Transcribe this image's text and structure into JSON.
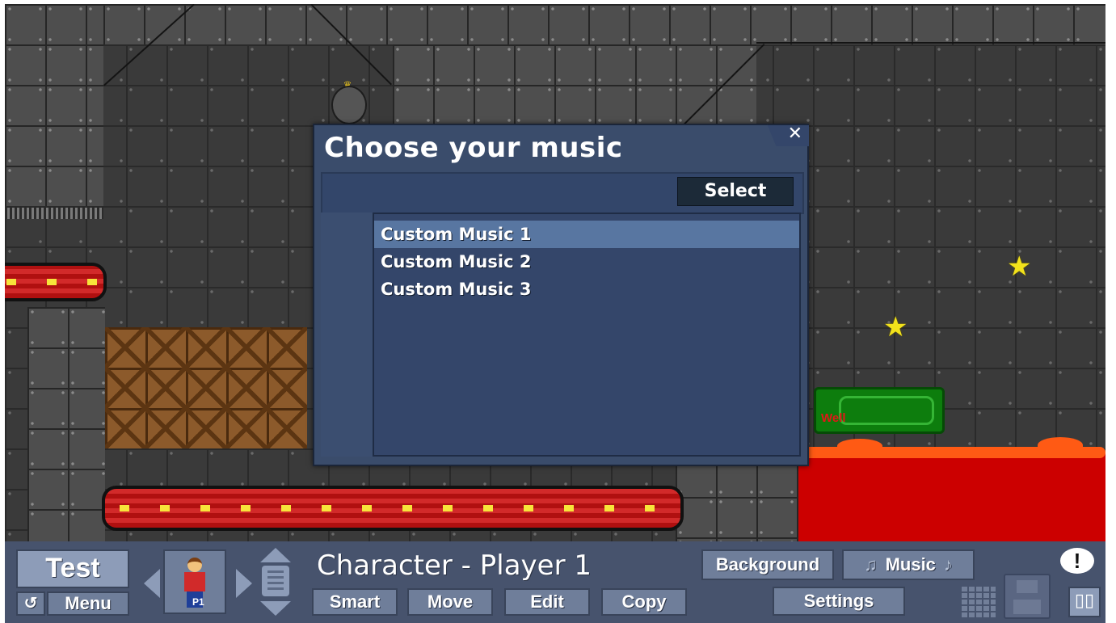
{
  "dialog": {
    "title": "Choose your music",
    "close_glyph": "✕",
    "select_label": "Select",
    "items": [
      {
        "label": "Custom Music 1",
        "selected": true
      },
      {
        "label": "Custom Music 2",
        "selected": false
      },
      {
        "label": "Custom Music 3",
        "selected": false
      }
    ]
  },
  "scene": {
    "goal_label": "Well"
  },
  "toolbar": {
    "test_label": "Test",
    "undo_glyph": "↺",
    "menu_label": "Menu",
    "character_title": "Character - Player 1",
    "avatar_tag": "P1",
    "smart_label": "Smart",
    "move_label": "Move",
    "edit_label": "Edit",
    "copy_label": "Copy",
    "background_label": "Background",
    "music_label": "Music",
    "music_glyph_left": "♫",
    "music_glyph_right": "♪",
    "settings_label": "Settings",
    "feedback_glyph": "!",
    "book_glyph": "▯▯"
  },
  "colors": {
    "dialog_bg": "#3a4c6b",
    "toolbar_bg": "#47536d",
    "lava": "#cc0000",
    "star": "#f2e21b"
  },
  "icons": [
    "close-icon",
    "undo-icon",
    "music-note-icon",
    "grid-icon",
    "save-icon",
    "feedback-icon",
    "book-icon",
    "star-icon",
    "bomb-icon"
  ]
}
